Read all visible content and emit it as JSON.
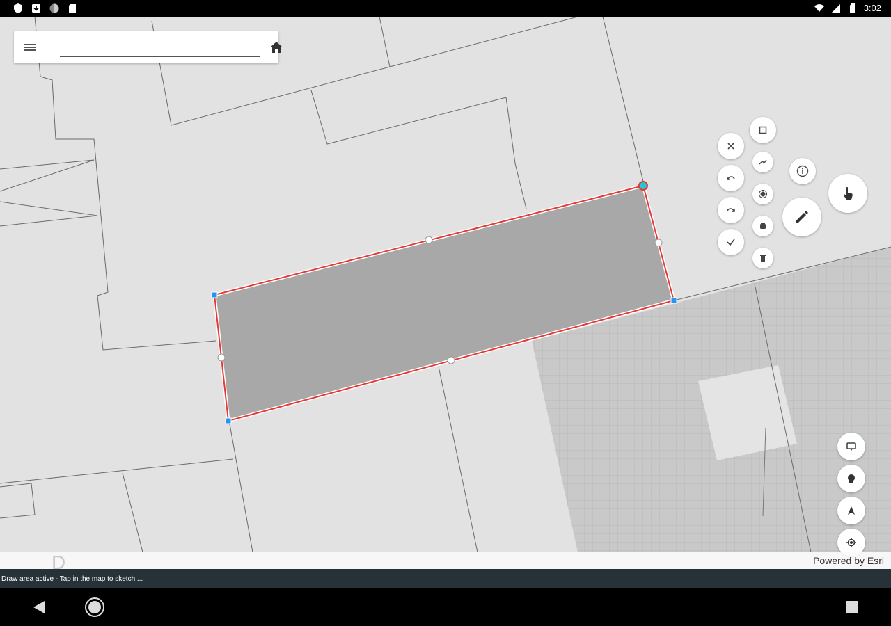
{
  "status_bar": {
    "time": "3:02",
    "icons": [
      "shield-icon",
      "download-icon",
      "sync-icon",
      "sd-card-icon",
      "wifi-icon",
      "signal-icon",
      "battery-icon"
    ]
  },
  "search": {
    "value": "",
    "placeholder": "",
    "menu_icon": "menu-icon",
    "home_icon": "home-icon"
  },
  "sketch_toolbar": {
    "tools": [
      "cancel-icon",
      "undo-icon",
      "redo-icon",
      "confirm-icon",
      "polygon-icon",
      "polyline-icon",
      "point-icon",
      "erase-icon",
      "delete-icon",
      "info-icon",
      "edit-icon",
      "touch-select-icon"
    ]
  },
  "map_controls": [
    "compass-icon",
    "layers-icon",
    "navigate-icon",
    "locate-icon"
  ],
  "attribution": "Powered by Esri",
  "attribution_logo_partial": "D",
  "draw_status": "Draw area active - Tap in the map to sketch ...",
  "colors": {
    "sketch_stroke": "#e53935",
    "sketch_fill": "#a8a8a8",
    "vertex_selected": "#26c6da",
    "vertex_end": "#2196f3",
    "draw_bar": "#263238"
  }
}
